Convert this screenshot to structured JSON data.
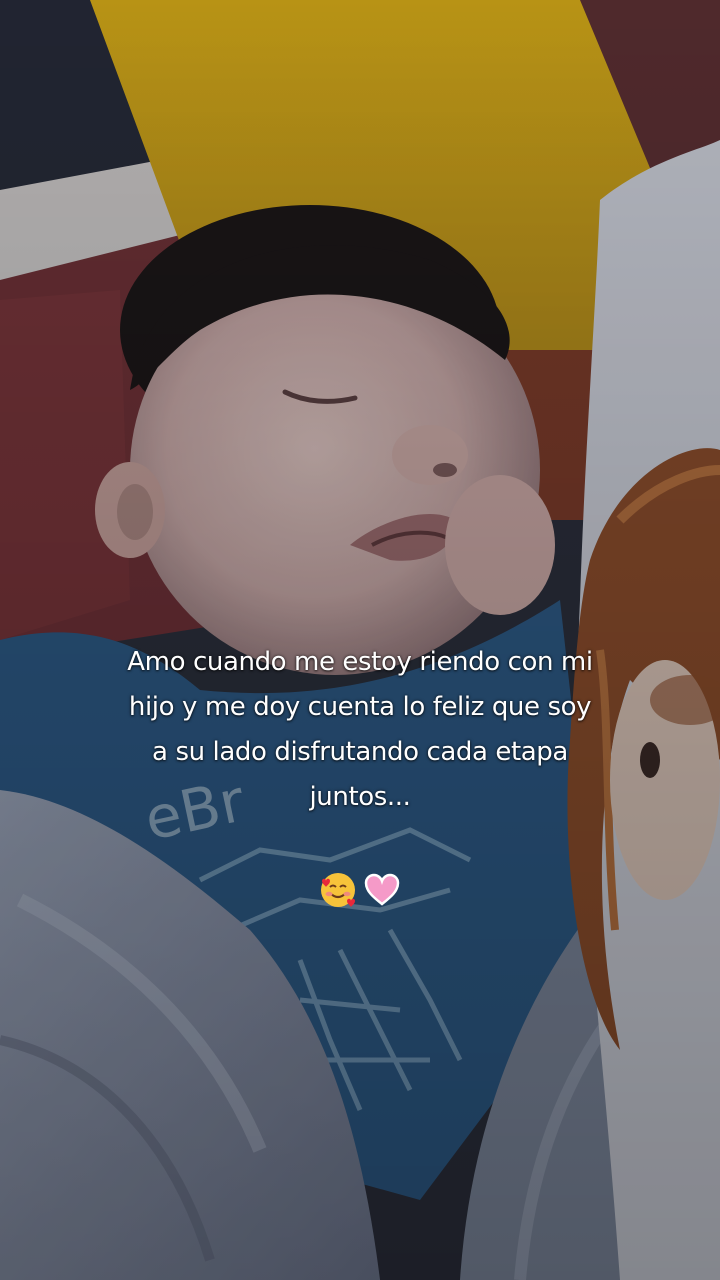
{
  "caption": {
    "line1": "Amo cuando me estoy riendo con mi",
    "line2": "hijo y me doy cuenta lo feliz que soy",
    "line3": "a su lado disfrutando cada etapa",
    "line4": "juntos..."
  },
  "shirt_print": "eBr",
  "emojis": [
    "smiling-face-with-hearts",
    "pink-heart"
  ],
  "colors": {
    "background_yellow": "#c9a21e",
    "blanket": "#8e98ad",
    "shirt": "#2d5a86",
    "caption_text": "#ffffff"
  }
}
